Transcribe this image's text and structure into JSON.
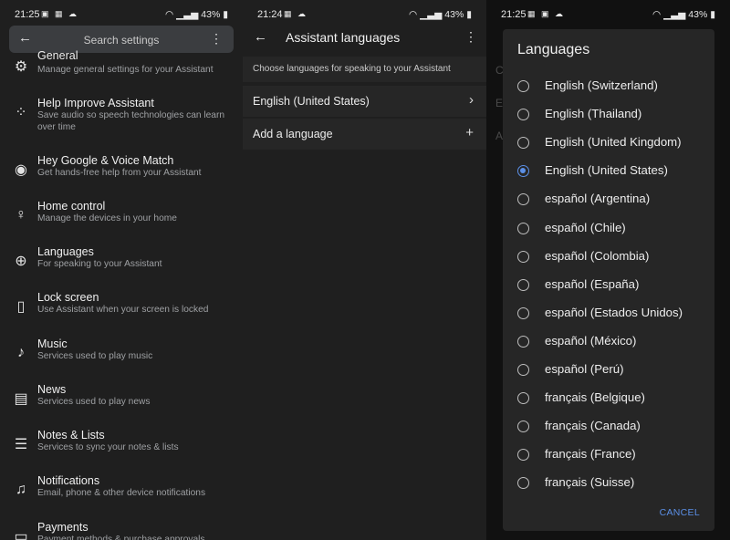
{
  "panel1": {
    "status": {
      "time": "21:25",
      "icons": "▣ ▦ ☁",
      "battery": "43%"
    },
    "search": {
      "placeholder": "Search settings"
    },
    "items": [
      {
        "title": "General",
        "subtitle": "Manage general settings for your Assistant",
        "icon": "gear-icon"
      },
      {
        "title": "Help Improve Assistant",
        "subtitle": "Save audio so speech technologies can learn over time",
        "icon": "dots-icon"
      },
      {
        "title": "Hey Google & Voice Match",
        "subtitle": "Get hands-free help from your Assistant",
        "icon": "voice-match-icon"
      },
      {
        "title": "Home control",
        "subtitle": "Manage the devices in your home",
        "icon": "lightbulb-icon"
      },
      {
        "title": "Languages",
        "subtitle": "For speaking to your Assistant",
        "icon": "globe-icon"
      },
      {
        "title": "Lock screen",
        "subtitle": "Use Assistant when your screen is locked",
        "icon": "lock-screen-icon"
      },
      {
        "title": "Music",
        "subtitle": "Services used to play music",
        "icon": "music-note-icon"
      },
      {
        "title": "News",
        "subtitle": "Services used to play news",
        "icon": "news-icon"
      },
      {
        "title": "Notes & Lists",
        "subtitle": "Services to sync your notes & lists",
        "icon": "list-icon"
      },
      {
        "title": "Notifications",
        "subtitle": "Email, phone & other device notifications",
        "icon": "bell-icon"
      },
      {
        "title": "Payments",
        "subtitle": "Payment methods & purchase approvals",
        "icon": "card-icon"
      }
    ]
  },
  "panel2": {
    "status": {
      "time": "21:24",
      "icons": "▦ ☁",
      "battery": "43%"
    },
    "title": "Assistant languages",
    "info": "Choose languages for speaking to your Assistant",
    "language": "English (United States)",
    "add": "Add a language"
  },
  "panel3": {
    "status": {
      "time": "21:25",
      "icons": "▦ ▣ ☁",
      "battery": "43%"
    },
    "bg_letters": [
      "C",
      "E",
      "A"
    ],
    "dialog_title": "Languages",
    "options": [
      "English (Switzerland)",
      "English (Thailand)",
      "English (United Kingdom)",
      "English (United States)",
      "español (Argentina)",
      "español (Chile)",
      "español (Colombia)",
      "español (España)",
      "español (Estados Unidos)",
      "español (México)",
      "español (Perú)",
      "français (Belgique)",
      "français (Canada)",
      "français (France)",
      "français (Suisse)"
    ],
    "selected": "English (United States)",
    "cancel": "CANCEL"
  },
  "colors": {
    "accent": "#5b8fe6",
    "background": "#1f1f1f",
    "dialog": "#262626"
  }
}
